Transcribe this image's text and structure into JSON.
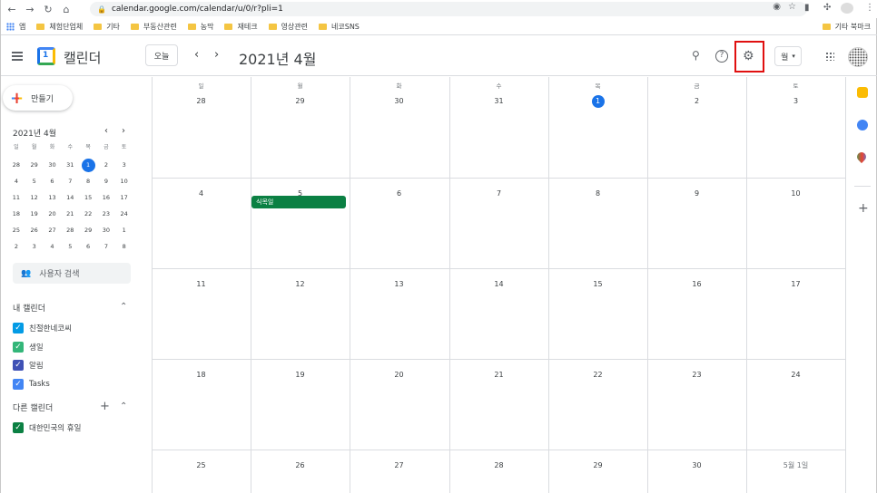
{
  "browser": {
    "url": "calendar.google.com/calendar/u/0/r?pli=1",
    "bookmarks": [
      "앱",
      "체험단업체",
      "기타",
      "부동산관련",
      "농막",
      "재테크",
      "영상관련",
      "네코SNS"
    ],
    "bookmarks_right": "기타 북마크"
  },
  "header": {
    "app_name": "캘린더",
    "logo_day": "1",
    "today_label": "오늘",
    "month_title": "2021년 4월",
    "view_label": "월"
  },
  "sidebar": {
    "create_label": "만들기",
    "mini_title": "2021년 4월",
    "weekdays": [
      "일",
      "월",
      "화",
      "수",
      "목",
      "금",
      "토"
    ],
    "weeks": [
      [
        "28",
        "29",
        "30",
        "31",
        "1",
        "2",
        "3"
      ],
      [
        "4",
        "5",
        "6",
        "7",
        "8",
        "9",
        "10"
      ],
      [
        "11",
        "12",
        "13",
        "14",
        "15",
        "16",
        "17"
      ],
      [
        "18",
        "19",
        "20",
        "21",
        "22",
        "23",
        "24"
      ],
      [
        "25",
        "26",
        "27",
        "28",
        "29",
        "30",
        "1"
      ],
      [
        "2",
        "3",
        "4",
        "5",
        "6",
        "7",
        "8"
      ]
    ],
    "people_search": "사용자 검색",
    "my_calendars_title": "내 캘린더",
    "my_calendars": [
      {
        "name": "친절한네코씨",
        "color": "#039be5"
      },
      {
        "name": "생일",
        "color": "#33b679"
      },
      {
        "name": "알림",
        "color": "#3f51b5"
      },
      {
        "name": "Tasks",
        "color": "#4285f4"
      }
    ],
    "other_calendars_title": "다른 캘린더",
    "other_calendars": [
      {
        "name": "대한민국의 휴일",
        "color": "#0b8043"
      }
    ]
  },
  "month": {
    "weekdays": [
      "일",
      "월",
      "화",
      "수",
      "목",
      "금",
      "토"
    ],
    "weeks": [
      [
        "28",
        "29",
        "30",
        "31",
        "1",
        "2",
        "3"
      ],
      [
        "4",
        "5",
        "6",
        "7",
        "8",
        "9",
        "10"
      ],
      [
        "11",
        "12",
        "13",
        "14",
        "15",
        "16",
        "17"
      ],
      [
        "18",
        "19",
        "20",
        "21",
        "22",
        "23",
        "24"
      ],
      [
        "25",
        "26",
        "27",
        "28",
        "29",
        "30",
        "5월 1일"
      ]
    ],
    "today": "1",
    "event": {
      "title": "식목일",
      "color": "#0b8043"
    }
  }
}
